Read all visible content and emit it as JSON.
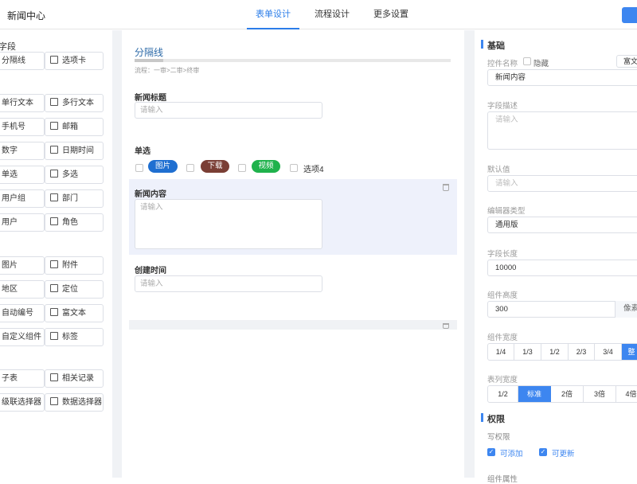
{
  "header": {
    "app_title": "新闻中心",
    "tabs": [
      {
        "label": "表单设计",
        "active": true
      },
      {
        "label": "流程设计",
        "active": false
      },
      {
        "label": "更多设置",
        "active": false
      }
    ]
  },
  "palette": {
    "section_fields": "字段",
    "items": [
      "分隔线",
      "选项卡",
      "单行文本",
      "多行文本",
      "手机号",
      "邮箱",
      "数字",
      "日期时间",
      "单选",
      "多选",
      "用户组",
      "部门",
      "用户",
      "角色",
      "图片",
      "附件",
      "地区",
      "定位",
      "自动编号",
      "富文本",
      "自定义组件",
      "标签",
      "子表",
      "相关记录",
      "级联选择器",
      "数据选择器"
    ]
  },
  "canvas": {
    "divider_title": "分隔线",
    "flow_text": "流程：一审>二审>终审",
    "fields": {
      "news_title": {
        "label": "新闻标题",
        "placeholder": "请输入"
      },
      "single_choice": {
        "label": "单选",
        "options": [
          {
            "label": "图片",
            "color": "#1f6fd1"
          },
          {
            "label": "下载",
            "color": "#7a3e35"
          },
          {
            "label": "视频",
            "color": "#1fb24c"
          },
          {
            "label": "选项4",
            "color": ""
          }
        ]
      },
      "news_content": {
        "label": "新闻内容",
        "placeholder": "请输入"
      },
      "created_time": {
        "label": "创建时间",
        "placeholder": "请输入"
      }
    }
  },
  "props": {
    "basic_title": "基础",
    "control_name_label": "控件名称",
    "hidden_label": "隐藏",
    "rich_badge": "富文",
    "control_name_value": "新闻内容",
    "field_desc_label": "字段描述",
    "field_desc_placeholder": "请输入",
    "default_label": "默认值",
    "default_placeholder": "请输入",
    "editor_type_label": "编辑器类型",
    "editor_type_value": "通用版",
    "field_length_label": "字段长度",
    "field_length_value": "10000",
    "height_label": "组件高度",
    "height_value": "300",
    "height_unit": "像素",
    "width_label": "组件宽度",
    "width_options": [
      "1/4",
      "1/3",
      "1/2",
      "2/3",
      "3/4",
      "整"
    ],
    "width_selected": "整",
    "list_width_label": "表列宽度",
    "list_width_options": [
      "1/2",
      "标准",
      "2倍",
      "3倍",
      "4倍"
    ],
    "list_width_selected": "标准",
    "perm_title": "权限",
    "write_perm_label": "写权限",
    "can_add_label": "可添加",
    "can_update_label": "可更新",
    "comp_attr_label": "组件属性"
  },
  "colors": {
    "accent": "#3d86f0",
    "divider_title": "#2d6aa8"
  }
}
